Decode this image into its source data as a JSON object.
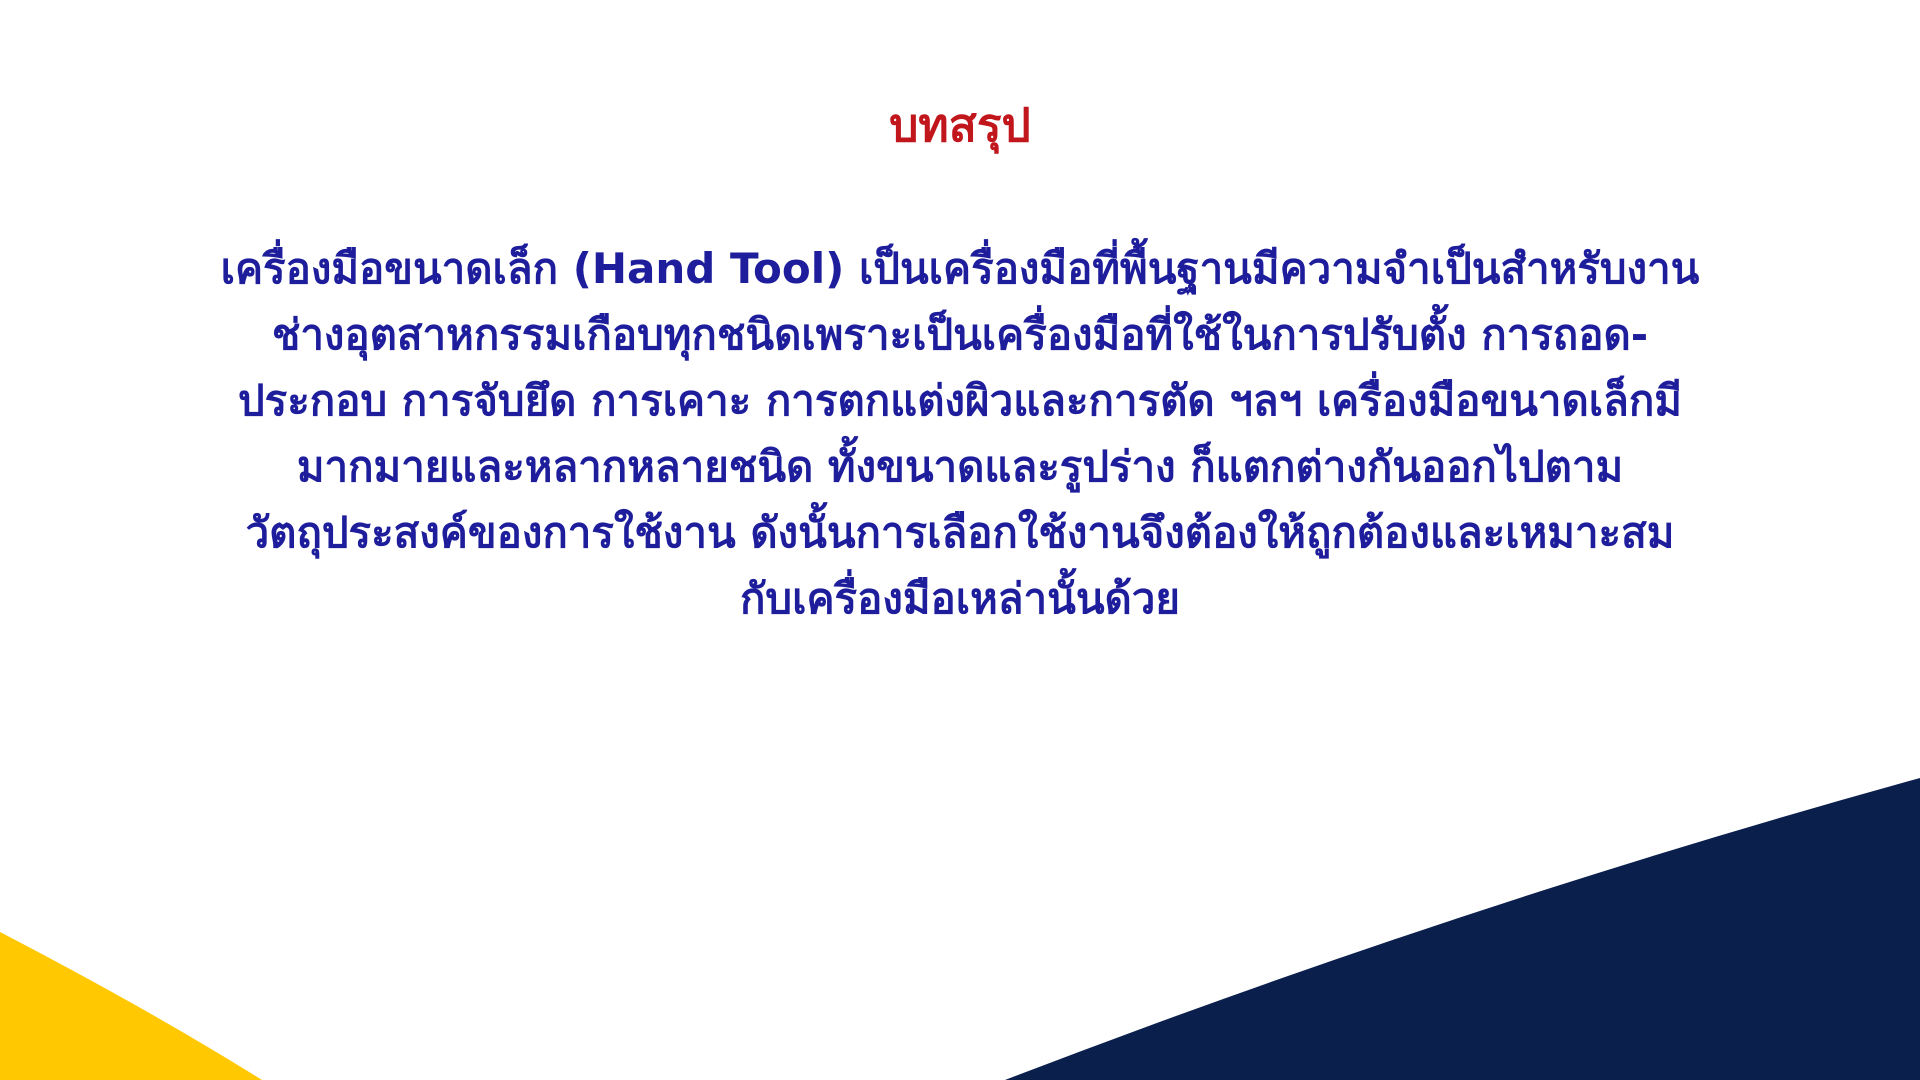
{
  "slide": {
    "title": "บทสรุป",
    "body_lines": [
      "เครื่องมือขนาดเล็ก (Hand Tool) เป็นเครื่องมือที่พื้นฐานมีความจำเป็นสำหรับงาน",
      "ช่างอุตสาหกรรมเกือบทุกชนิดเพราะเป็นเครื่องมือที่ใช้ในการปรับตั้ง การถอด-",
      "ประกอบ การจับยึด การเคาะ การตกแต่งผิวและการตัด ฯลฯ เครื่องมือขนาดเล็กมี",
      "มากมายและหลากหลายชนิด ทั้งขนาดและรูปร่าง ก็แตกต่างกันออกไปตาม",
      "วัตถุประสงค์ของการใช้งาน ดังนั้นการเลือกใช้งานจึงต้องให้ถูกต้องและเหมาะสม",
      "กับเครื่องมือเหล่านั้นด้วย"
    ]
  },
  "colors": {
    "title": "#c0161c",
    "body": "#1e1e9c",
    "navy_shape": "#0b1f4d",
    "yellow_shape": "#ffc800",
    "background": "#ffffff"
  }
}
